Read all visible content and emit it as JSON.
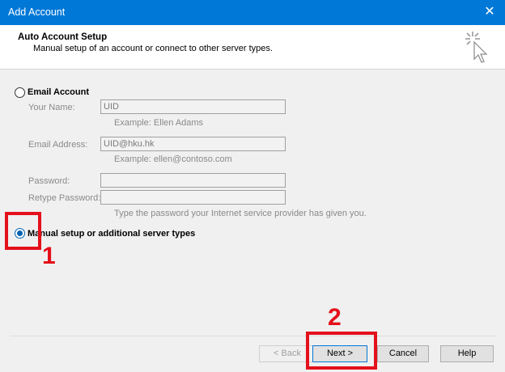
{
  "window": {
    "title": "Add Account",
    "close_glyph": "✕"
  },
  "header": {
    "title": "Auto Account Setup",
    "subtitle": "Manual setup of an account or connect to other server types.",
    "icon": "setup-wand-icon"
  },
  "options": {
    "email_account": {
      "label": "Email Account",
      "selected": false
    },
    "manual_setup": {
      "label": "Manual setup or additional server types",
      "selected": true
    }
  },
  "form": {
    "your_name": {
      "label": "Your Name:",
      "value": "UID",
      "hint": "Example: Ellen Adams"
    },
    "email_address": {
      "label": "Email Address:",
      "value": "UID@hku.hk",
      "hint": "Example: ellen@contoso.com"
    },
    "password": {
      "label": "Password:",
      "value": ""
    },
    "retype_password": {
      "label": "Retype Password:",
      "value": ""
    },
    "password_hint": "Type the password your Internet service provider has given you."
  },
  "buttons": {
    "back": "< Back",
    "next": "Next >",
    "cancel": "Cancel",
    "help": "Help"
  },
  "annotations": {
    "step1": "1",
    "step2": "2",
    "color": "#e4101b"
  },
  "colors": {
    "titlebar": "#0078d7",
    "radio_selected": "#0063b1"
  }
}
